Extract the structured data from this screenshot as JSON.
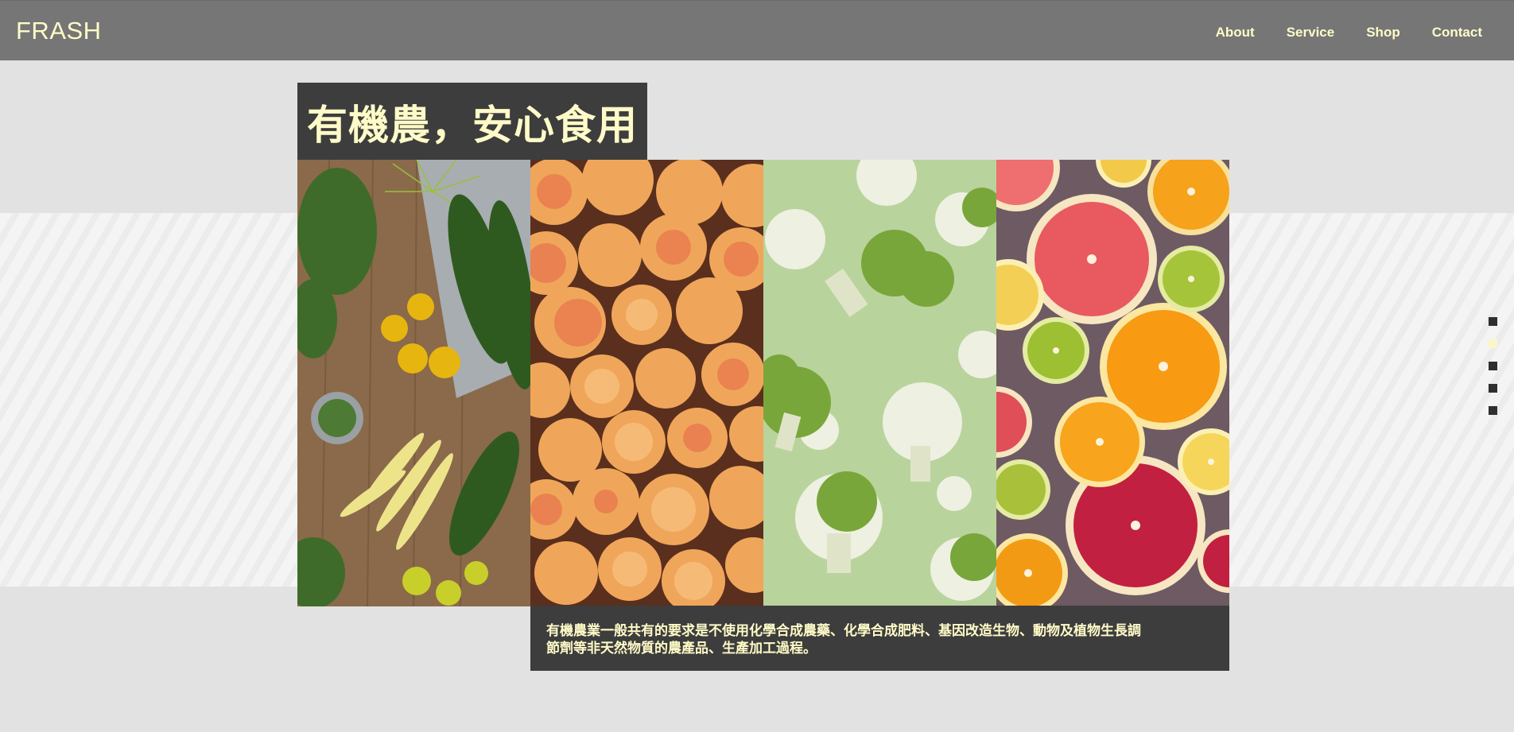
{
  "header": {
    "brand": "FRASH",
    "nav": [
      {
        "label": "About"
      },
      {
        "label": "Service"
      },
      {
        "label": "Shop"
      },
      {
        "label": "Contact"
      }
    ]
  },
  "hero": {
    "title": "有機農，安心食用",
    "caption_line1": "有機農業一般共有的要求是不使用化學合成農藥、化學合成肥料、基因改造生物、動物及植物生長調",
    "caption_line2": "節劑等非天然物質的農產品、生產加工過程。"
  },
  "gallery": {
    "panels": [
      {
        "subject": "vegetables-on-wood"
      },
      {
        "subject": "apricots"
      },
      {
        "subject": "cauliflower-broccoli"
      },
      {
        "subject": "citrus-slices"
      }
    ]
  },
  "pager": {
    "count": 5,
    "active_index": 1
  },
  "colors": {
    "accent": "#fffbc8",
    "navbar": "#767676",
    "dark_box": "#3d3d3d",
    "background": "#e2e2e2"
  }
}
